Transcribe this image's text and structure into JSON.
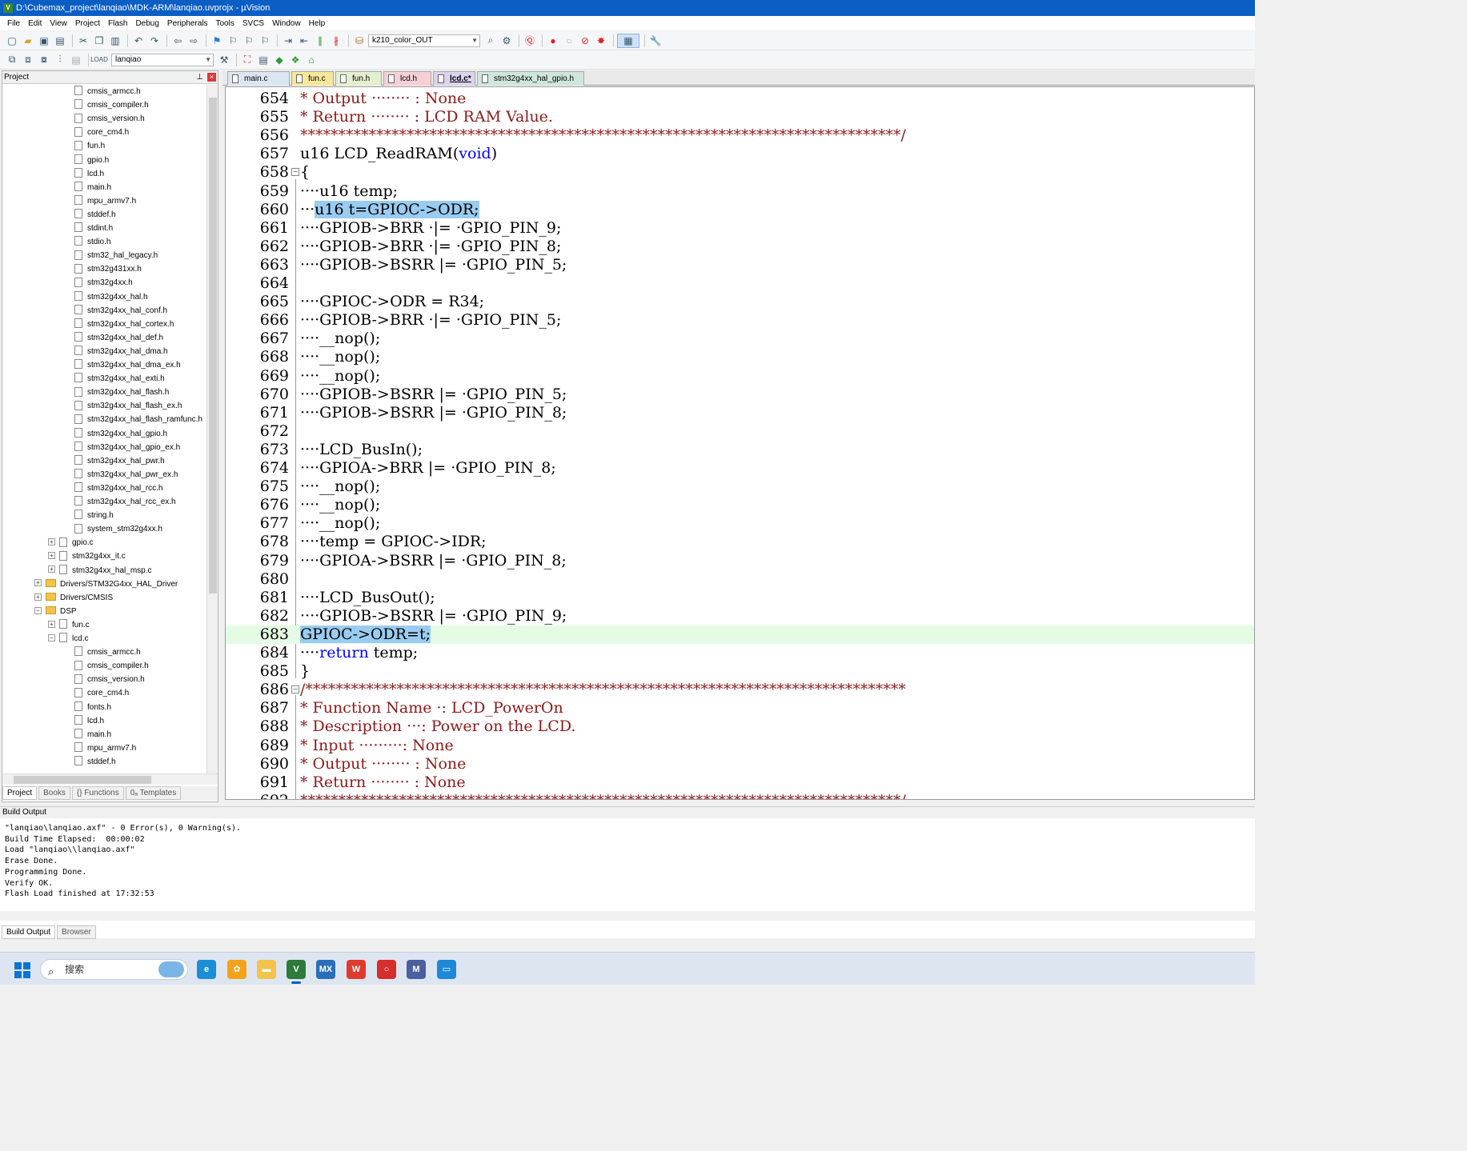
{
  "window": {
    "title": "D:\\Cubemax_project\\lanqiao\\MDK-ARM\\lanqiao.uvprojx - µVision"
  },
  "menu": [
    "File",
    "Edit",
    "View",
    "Project",
    "Flash",
    "Debug",
    "Peripherals",
    "Tools",
    "SVCS",
    "Window",
    "Help"
  ],
  "toolbar": {
    "target_combo": "k210_color_OUT",
    "project_combo": "lanqiao"
  },
  "project_panel": {
    "title": "Project",
    "items": [
      {
        "label": "cmsis_armcc.h",
        "indent": 3,
        "type": "file"
      },
      {
        "label": "cmsis_compiler.h",
        "indent": 3,
        "type": "file"
      },
      {
        "label": "cmsis_version.h",
        "indent": 3,
        "type": "file"
      },
      {
        "label": "core_cm4.h",
        "indent": 3,
        "type": "file"
      },
      {
        "label": "fun.h",
        "indent": 3,
        "type": "file"
      },
      {
        "label": "gpio.h",
        "indent": 3,
        "type": "file"
      },
      {
        "label": "lcd.h",
        "indent": 3,
        "type": "file"
      },
      {
        "label": "main.h",
        "indent": 3,
        "type": "file"
      },
      {
        "label": "mpu_armv7.h",
        "indent": 3,
        "type": "file"
      },
      {
        "label": "stddef.h",
        "indent": 3,
        "type": "file"
      },
      {
        "label": "stdint.h",
        "indent": 3,
        "type": "file"
      },
      {
        "label": "stdio.h",
        "indent": 3,
        "type": "file"
      },
      {
        "label": "stm32_hal_legacy.h",
        "indent": 3,
        "type": "file"
      },
      {
        "label": "stm32g431xx.h",
        "indent": 3,
        "type": "file"
      },
      {
        "label": "stm32g4xx.h",
        "indent": 3,
        "type": "file"
      },
      {
        "label": "stm32g4xx_hal.h",
        "indent": 3,
        "type": "file"
      },
      {
        "label": "stm32g4xx_hal_conf.h",
        "indent": 3,
        "type": "file"
      },
      {
        "label": "stm32g4xx_hal_cortex.h",
        "indent": 3,
        "type": "file"
      },
      {
        "label": "stm32g4xx_hal_def.h",
        "indent": 3,
        "type": "file"
      },
      {
        "label": "stm32g4xx_hal_dma.h",
        "indent": 3,
        "type": "file"
      },
      {
        "label": "stm32g4xx_hal_dma_ex.h",
        "indent": 3,
        "type": "file"
      },
      {
        "label": "stm32g4xx_hal_exti.h",
        "indent": 3,
        "type": "file"
      },
      {
        "label": "stm32g4xx_hal_flash.h",
        "indent": 3,
        "type": "file"
      },
      {
        "label": "stm32g4xx_hal_flash_ex.h",
        "indent": 3,
        "type": "file"
      },
      {
        "label": "stm32g4xx_hal_flash_ramfunc.h",
        "indent": 3,
        "type": "file"
      },
      {
        "label": "stm32g4xx_hal_gpio.h",
        "indent": 3,
        "type": "file"
      },
      {
        "label": "stm32g4xx_hal_gpio_ex.h",
        "indent": 3,
        "type": "file"
      },
      {
        "label": "stm32g4xx_hal_pwr.h",
        "indent": 3,
        "type": "file"
      },
      {
        "label": "stm32g4xx_hal_pwr_ex.h",
        "indent": 3,
        "type": "file"
      },
      {
        "label": "stm32g4xx_hal_rcc.h",
        "indent": 3,
        "type": "file"
      },
      {
        "label": "stm32g4xx_hal_rcc_ex.h",
        "indent": 3,
        "type": "file"
      },
      {
        "label": "string.h",
        "indent": 3,
        "type": "file"
      },
      {
        "label": "system_stm32g4xx.h",
        "indent": 3,
        "type": "file"
      },
      {
        "label": "gpio.c",
        "indent": 2,
        "type": "file",
        "expander": "+"
      },
      {
        "label": "stm32g4xx_it.c",
        "indent": 2,
        "type": "file",
        "expander": "+"
      },
      {
        "label": "stm32g4xx_hal_msp.c",
        "indent": 2,
        "type": "file",
        "expander": "+"
      },
      {
        "label": "Drivers/STM32G4xx_HAL_Driver",
        "indent": 1,
        "type": "folder",
        "expander": "+"
      },
      {
        "label": "Drivers/CMSIS",
        "indent": 1,
        "type": "folder",
        "expander": "+"
      },
      {
        "label": "DSP",
        "indent": 1,
        "type": "folder",
        "expander": "−"
      },
      {
        "label": "fun.c",
        "indent": 2,
        "type": "file",
        "expander": "+"
      },
      {
        "label": "lcd.c",
        "indent": 2,
        "type": "file",
        "expander": "−"
      },
      {
        "label": "cmsis_armcc.h",
        "indent": 3,
        "type": "file"
      },
      {
        "label": "cmsis_compiler.h",
        "indent": 3,
        "type": "file"
      },
      {
        "label": "cmsis_version.h",
        "indent": 3,
        "type": "file"
      },
      {
        "label": "core_cm4.h",
        "indent": 3,
        "type": "file"
      },
      {
        "label": "fonts.h",
        "indent": 3,
        "type": "file"
      },
      {
        "label": "lcd.h",
        "indent": 3,
        "type": "file"
      },
      {
        "label": "main.h",
        "indent": 3,
        "type": "file"
      },
      {
        "label": "mpu_armv7.h",
        "indent": 3,
        "type": "file"
      },
      {
        "label": "stddef.h",
        "indent": 3,
        "type": "file"
      }
    ],
    "tabs": [
      "Project",
      "Books",
      "{} Functions",
      "0ₐ Templates"
    ]
  },
  "editor_tabs": [
    {
      "label": "main.c",
      "color": "#dbe6f2",
      "active": false
    },
    {
      "label": "fun.c",
      "color": "#f7e79a",
      "active": false
    },
    {
      "label": "fun.h",
      "color": "#e4efcf",
      "active": false
    },
    {
      "label": "lcd.h",
      "color": "#f5d0d6",
      "active": false
    },
    {
      "label": "lcd.c*",
      "color": "#dcd3ee",
      "active": true
    },
    {
      "label": "stm32g4xx_hal_gpio.h",
      "color": "#cfe6da",
      "active": false
    }
  ],
  "code_lines": [
    {
      "n": "654",
      "segs": [
        [
          "* Output ········ : None",
          "com"
        ]
      ]
    },
    {
      "n": "655",
      "segs": [
        [
          "* Return ········ : LCD RAM Value.",
          "com"
        ]
      ]
    },
    {
      "n": "656",
      "segs": [
        [
          "*******************************************************************************/",
          "com"
        ]
      ]
    },
    {
      "n": "657",
      "segs": [
        [
          "u16 LCD_ReadRAM(",
          "txt"
        ],
        [
          "void",
          "kw"
        ],
        [
          ")",
          "txt"
        ]
      ]
    },
    {
      "n": "658",
      "fold": "−",
      "segs": [
        [
          "{",
          "txt"
        ]
      ]
    },
    {
      "n": "659",
      "segs": [
        [
          "····u16 temp;",
          "txt"
        ]
      ]
    },
    {
      "n": "660",
      "segs": [
        [
          "···",
          "txt"
        ],
        [
          "u16 t=GPIOC->ODR;",
          "sel"
        ]
      ]
    },
    {
      "n": "661",
      "segs": [
        [
          "····GPIOB->BRR ·|= ·GPIO_PIN_9;",
          "txt"
        ]
      ]
    },
    {
      "n": "662",
      "segs": [
        [
          "····GPIOB->BRR ·|= ·GPIO_PIN_8;",
          "txt"
        ]
      ]
    },
    {
      "n": "663",
      "segs": [
        [
          "····GPIOB->BSRR |= ·GPIO_PIN_5;",
          "txt"
        ]
      ]
    },
    {
      "n": "664",
      "segs": [
        [
          "",
          "txt"
        ]
      ]
    },
    {
      "n": "665",
      "segs": [
        [
          "····GPIOC->ODR = R34;",
          "txt"
        ]
      ]
    },
    {
      "n": "666",
      "segs": [
        [
          "····GPIOB->BRR ·|= ·GPIO_PIN_5;",
          "txt"
        ]
      ]
    },
    {
      "n": "667",
      "segs": [
        [
          "····__nop();",
          "txt"
        ]
      ]
    },
    {
      "n": "668",
      "segs": [
        [
          "····__nop();",
          "txt"
        ]
      ]
    },
    {
      "n": "669",
      "segs": [
        [
          "····__nop();",
          "txt"
        ]
      ]
    },
    {
      "n": "670",
      "segs": [
        [
          "····GPIOB->BSRR |= ·GPIO_PIN_5;",
          "txt"
        ]
      ]
    },
    {
      "n": "671",
      "segs": [
        [
          "····GPIOB->BSRR |= ·GPIO_PIN_8;",
          "txt"
        ]
      ]
    },
    {
      "n": "672",
      "segs": [
        [
          "",
          "txt"
        ]
      ]
    },
    {
      "n": "673",
      "segs": [
        [
          "····LCD_BusIn();",
          "txt"
        ]
      ]
    },
    {
      "n": "674",
      "segs": [
        [
          "····GPIOA->BRR |= ·GPIO_PIN_8;",
          "txt"
        ]
      ]
    },
    {
      "n": "675",
      "segs": [
        [
          "····__nop();",
          "txt"
        ]
      ]
    },
    {
      "n": "676",
      "segs": [
        [
          "····__nop();",
          "txt"
        ]
      ]
    },
    {
      "n": "677",
      "segs": [
        [
          "····__nop();",
          "txt"
        ]
      ]
    },
    {
      "n": "678",
      "segs": [
        [
          "····temp = GPIOC->IDR;",
          "txt"
        ]
      ]
    },
    {
      "n": "679",
      "segs": [
        [
          "····GPIOA->BSRR |= ·GPIO_PIN_8;",
          "txt"
        ]
      ]
    },
    {
      "n": "680",
      "segs": [
        [
          "",
          "txt"
        ]
      ]
    },
    {
      "n": "681",
      "segs": [
        [
          "····LCD_BusOut();",
          "txt"
        ]
      ]
    },
    {
      "n": "682",
      "segs": [
        [
          "····GPIOB->BSRR |= ·GPIO_PIN_9;",
          "txt"
        ]
      ]
    },
    {
      "n": "683",
      "current": true,
      "segs": [
        [
          "GPIOC->ODR=t;",
          "sel"
        ]
      ]
    },
    {
      "n": "684",
      "segs": [
        [
          "····",
          "txt"
        ],
        [
          "return",
          "kw"
        ],
        [
          " temp;",
          "txt"
        ]
      ]
    },
    {
      "n": "685",
      "segs": [
        [
          "}",
          "txt"
        ]
      ]
    },
    {
      "n": "686",
      "fold": "−",
      "segs": [
        [
          "/*******************************************************************************",
          "com"
        ]
      ]
    },
    {
      "n": "687",
      "segs": [
        [
          "* Function Name ·: LCD_PowerOn",
          "com"
        ]
      ]
    },
    {
      "n": "688",
      "segs": [
        [
          "* Description ···: Power on the LCD.",
          "com"
        ]
      ]
    },
    {
      "n": "689",
      "segs": [
        [
          "* Input ·········: None",
          "com"
        ]
      ]
    },
    {
      "n": "690",
      "segs": [
        [
          "* Output ········ : None",
          "com"
        ]
      ]
    },
    {
      "n": "691",
      "segs": [
        [
          "* Return ········ : None",
          "com"
        ]
      ]
    },
    {
      "n": "692",
      "segs": [
        [
          "*******************************************************************************/",
          "com"
        ]
      ]
    }
  ],
  "build_output": {
    "title": "Build Output",
    "text": "\"lanqiao\\lanqiao.axf\" - 0 Error(s), 0 Warning(s).\nBuild Time Elapsed:  00:00:02\nLoad \"lanqiao\\\\lanqiao.axf\"\nErase Done.\nProgramming Done.\nVerify OK.\nFlash Load finished at 17:32:53",
    "tabs": [
      "Build Output",
      "Browser"
    ]
  },
  "taskbar": {
    "search_placeholder": "搜索",
    "apps": [
      {
        "name": "edge-icon",
        "color": "#1a8fd6",
        "glyph": "e"
      },
      {
        "name": "app-yellow-icon",
        "color": "#f4a21a",
        "glyph": "✿"
      },
      {
        "name": "file-explorer-icon",
        "color": "#f3c34a",
        "glyph": "▬"
      },
      {
        "name": "keil-uvision-icon",
        "color": "#2d7a3a",
        "glyph": "V",
        "active": true
      },
      {
        "name": "mx-icon",
        "color": "#2a6fb8",
        "glyph": "MX"
      },
      {
        "name": "wps-icon",
        "color": "#e03a2f",
        "glyph": "W"
      },
      {
        "name": "record-icon",
        "color": "#d62d2d",
        "glyph": "○"
      },
      {
        "name": "note-icon",
        "color": "#4b5f9e",
        "glyph": "M"
      },
      {
        "name": "remote-icon",
        "color": "#1e88d8",
        "glyph": "▭"
      }
    ]
  }
}
